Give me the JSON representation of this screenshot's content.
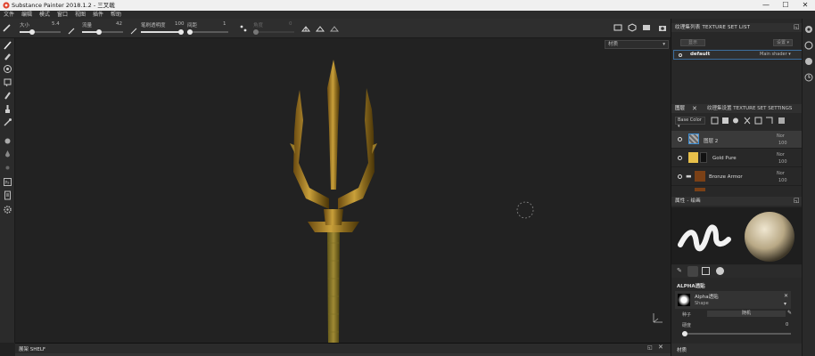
{
  "window": {
    "title": "Substance Painter 2018.1.2 - 三叉戟",
    "minimize": "—",
    "maximize": "☐",
    "close": "✕"
  },
  "menu": [
    "文件",
    "编辑",
    "模式",
    "窗口",
    "视图",
    "插件",
    "帮助"
  ],
  "toolbar": {
    "size_label": "大小",
    "size_value": "5.4",
    "flow_label": "流量",
    "flow_value": "42",
    "stroke_opacity_label": "笔刷透明度",
    "stroke_opacity_value": "100",
    "spacing_label": "间距",
    "spacing_value": "1",
    "angle_label": "角度",
    "angle_value": "0"
  },
  "viewport": {
    "dropdown_value": "材质",
    "dropdown_arrow": "▾"
  },
  "texture_set_list": {
    "header": "纹理集列表 TEXTURE SET LIST",
    "btn_left": "显示",
    "btn_right": "设置 ▾",
    "item_name": "default",
    "item_shader": "Main shader ▾"
  },
  "layers": {
    "tab_layers": "图层",
    "tab_settings": "纹理集设置 TEXTURE SET SETTINGS",
    "blend_dropdown": "Base Color ▾",
    "rows": [
      {
        "name": "图层 2",
        "blend": "Nor",
        "opacity": "100"
      },
      {
        "name": "Gold Pure",
        "blend": "Nor",
        "opacity": "100"
      },
      {
        "name": "Bronze Armor",
        "blend": "Nor",
        "opacity": "100"
      }
    ]
  },
  "properties": {
    "header": "属性 - 绘画",
    "alpha_section": "ALPHA透贴",
    "alpha_name": "Alpha透贴",
    "alpha_type": "Shape",
    "seed_label": "种子",
    "seed_value": "随机",
    "hardness_label": "硬度",
    "hardness_value": "0",
    "material_section": "材质"
  },
  "shelf": {
    "title": "展架 SHELF"
  }
}
